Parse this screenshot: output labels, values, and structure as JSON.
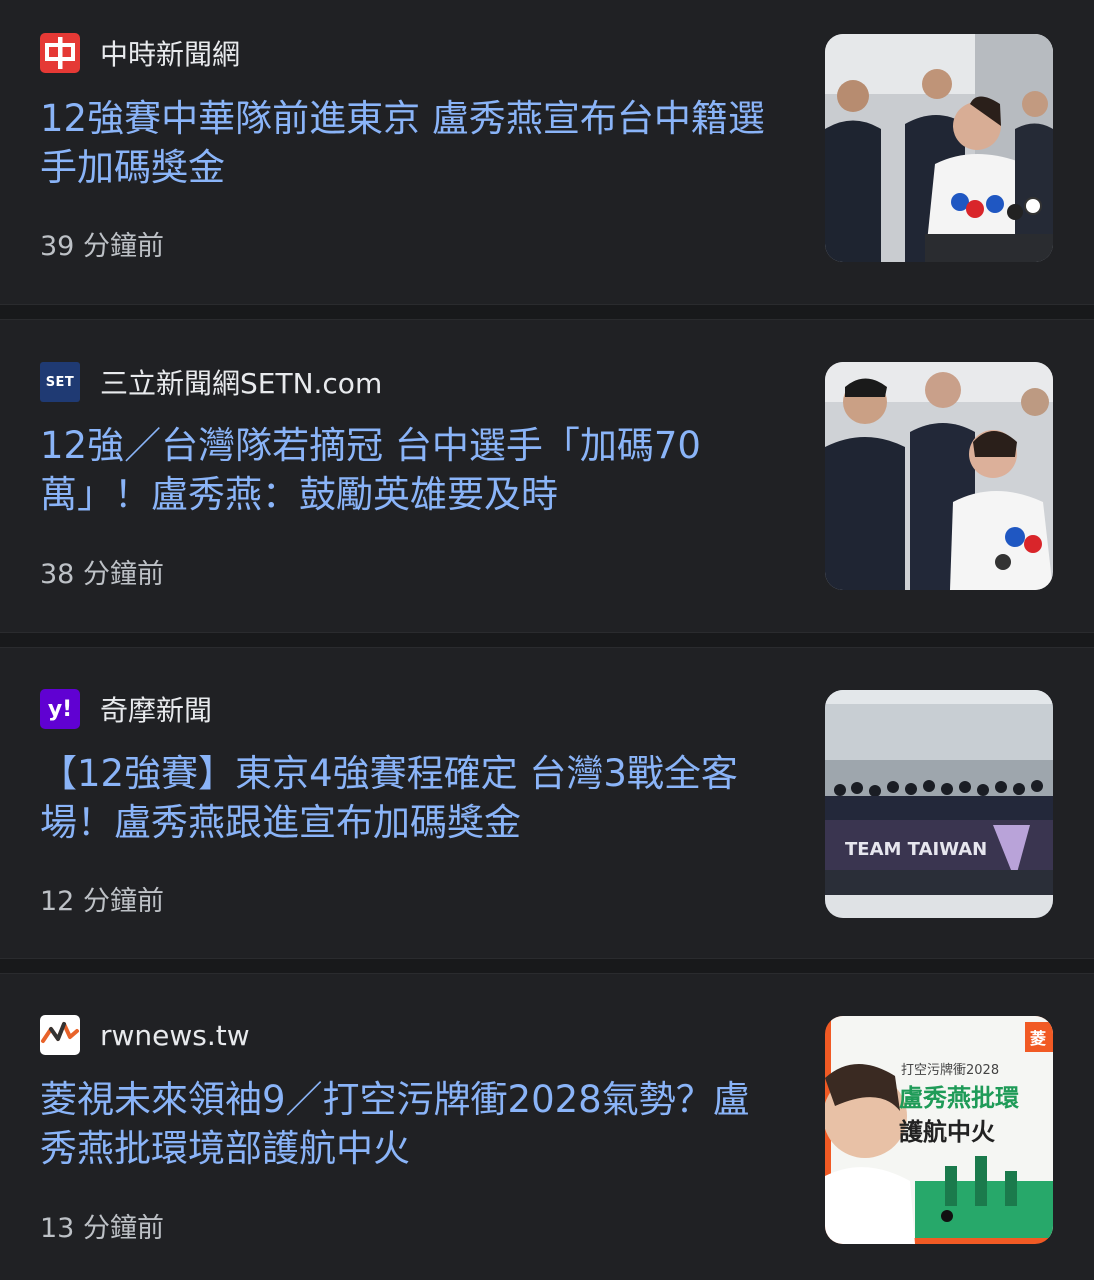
{
  "articles": [
    {
      "source": "中時新聞網",
      "logo_icon": "chinatimes-logo-icon",
      "logo_glyph": "中",
      "logo_color": "#e53935",
      "headline": "12強賽中華隊前進東京 盧秀燕宣布台中籍選手加碼獎金",
      "time": "39 分鐘前",
      "thumbnail": "press-conference-photo"
    },
    {
      "source": "三立新聞網SETN.com",
      "logo_icon": "setn-logo-icon",
      "logo_glyph": "SET",
      "logo_color": "#1f3a73",
      "headline": "12強／台灣隊若摘冠 台中選手「加碼70萬」！盧秀燕：鼓勵英雄要及時",
      "time": "38 分鐘前",
      "thumbnail": "officials-group-photo"
    },
    {
      "source": "奇摩新聞",
      "logo_icon": "yahoo-logo-icon",
      "logo_glyph": "y!",
      "logo_color": "#6001d2",
      "headline": "【12強賽】東京4強賽程確定 台灣3戰全客場！盧秀燕跟進宣布加碼獎金",
      "time": "12 分鐘前",
      "thumbnail": "team-taiwan-banner-photo",
      "thumbnail_banner": "TEAM TAIWAN"
    },
    {
      "source": "rwnews.tw",
      "logo_icon": "rwnews-logo-icon",
      "logo_glyph": "",
      "logo_color": "#ffffff",
      "headline": "菱視未來領袖9／打空污牌衝2028氣勢？盧秀燕批環境部護航中火",
      "time": "13 分鐘前",
      "thumbnail": "news-graphic-thumbnail",
      "thumbnail_text": {
        "top": "打空污牌衝2028",
        "mid": "盧秀燕批環",
        "bottom": "護航中火",
        "corner": "菱"
      }
    }
  ]
}
